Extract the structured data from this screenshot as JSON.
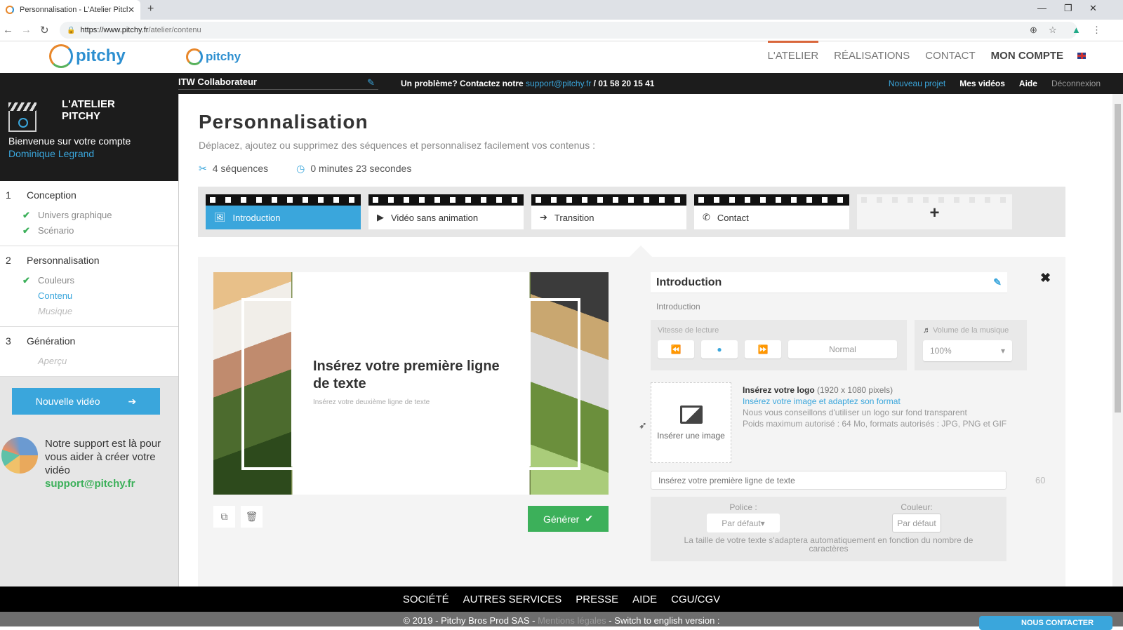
{
  "browser": {
    "tab_title": "Personnalisation - L'Atelier Pitchy",
    "url_domain": "https://www.pitchy.fr",
    "url_path": "/atelier/contenu"
  },
  "header": {
    "logo_text": "pitchy",
    "nav": [
      {
        "label": "L'ATELIER"
      },
      {
        "label": "RÉALISATIONS"
      },
      {
        "label": "CONTACT"
      },
      {
        "label": "MON COMPTE"
      }
    ]
  },
  "darkbar": {
    "project_name": "ITW Collaborateur",
    "help_prefix": "Un problème? Contactez notre ",
    "help_email": "support@pitchy.fr",
    "help_phone": " / 01 58 20 15 41",
    "links": [
      {
        "label": "Nouveau projet"
      },
      {
        "label": "Mes vidéos"
      },
      {
        "label": "Aide"
      },
      {
        "label": "Déconnexion"
      }
    ]
  },
  "sidebar": {
    "title_line1": "L'ATELIER",
    "title_line2": "PITCHY",
    "welcome": "Bienvenue sur votre compte",
    "user": "Dominique Legrand",
    "steps": [
      {
        "num": "1",
        "label": "Conception",
        "items": [
          {
            "label": "Univers graphique",
            "state": "done"
          },
          {
            "label": "Scénario",
            "state": "done"
          }
        ]
      },
      {
        "num": "2",
        "label": "Personnalisation",
        "items": [
          {
            "label": "Couleurs",
            "state": "done"
          },
          {
            "label": "Contenu",
            "state": "current"
          },
          {
            "label": "Musique",
            "state": "disabled"
          }
        ]
      },
      {
        "num": "3",
        "label": "Génération",
        "items": [
          {
            "label": "Aperçu",
            "state": "disabled"
          }
        ]
      }
    ],
    "new_video": "Nouvelle vidéo",
    "support_text": "Notre support est là pour vous aider à créer votre vidéo",
    "support_email": "support@pitchy.fr"
  },
  "main": {
    "title": "Personnalisation",
    "intro": "Déplacez, ajoutez ou supprimez des séquences et personnalisez facilement vos contenus :",
    "sequences_count": "4 séquences",
    "duration": "0 minutes 23 secondes",
    "sequences": [
      {
        "label": "Introduction",
        "icon": "image-icon",
        "active": true
      },
      {
        "label": "Vidéo sans animation",
        "icon": "play-icon",
        "active": false
      },
      {
        "label": "Transition",
        "icon": "arrow-right-icon",
        "active": false
      },
      {
        "label": "Contact",
        "icon": "phone-icon",
        "active": false
      }
    ],
    "add_sequence": "+"
  },
  "preview": {
    "line1": "Insérez votre première ligne de texte",
    "line2": "Insérez votre deuxième ligne de texte",
    "generate": "Générer"
  },
  "panel": {
    "title": "Introduction",
    "subtitle": "Introduction",
    "speed_label": "Vitesse de lecture",
    "speed_value": "Normal",
    "volume_label": "Volume de la musique",
    "volume_value": "100%",
    "insert_image": "Insérer une image",
    "logo_title": "Insérez votre logo",
    "logo_dims": " (1920 x 1080 pixels)",
    "logo_link": "Insérez votre image et adaptez son format",
    "logo_tip": "Nous vous conseillons d'utiliser un logo sur fond transparent",
    "logo_limits": "Poids maximum autorisé : 64 Mo, formats autorisés : JPG, PNG et GIF",
    "line1_placeholder": "Insérez votre première ligne de texte",
    "char_count": "60",
    "font_label": "Police :",
    "font_value": "Par défaut",
    "color_label": "Couleur:",
    "color_value": "Par défaut",
    "size_note": "La taille de votre texte s'adaptera automatiquement en fonction du nombre de caractères"
  },
  "footer": {
    "links": [
      {
        "label": "SOCIÉTÉ"
      },
      {
        "label": "AUTRES SERVICES"
      },
      {
        "label": "PRESSE"
      },
      {
        "label": "AIDE"
      },
      {
        "label": "CGU/CGV"
      }
    ],
    "copyright": "© 2019 - Pitchy Bros Prod SAS - ",
    "legal": "Mentions légales",
    "switch": " - Switch to english version : ",
    "contact_btn": "NOUS CONTACTER"
  },
  "colors": {
    "accent_blue": "#3aa6dc",
    "success_green": "#3cb05a",
    "active_nav_underline": "#d9663a"
  }
}
